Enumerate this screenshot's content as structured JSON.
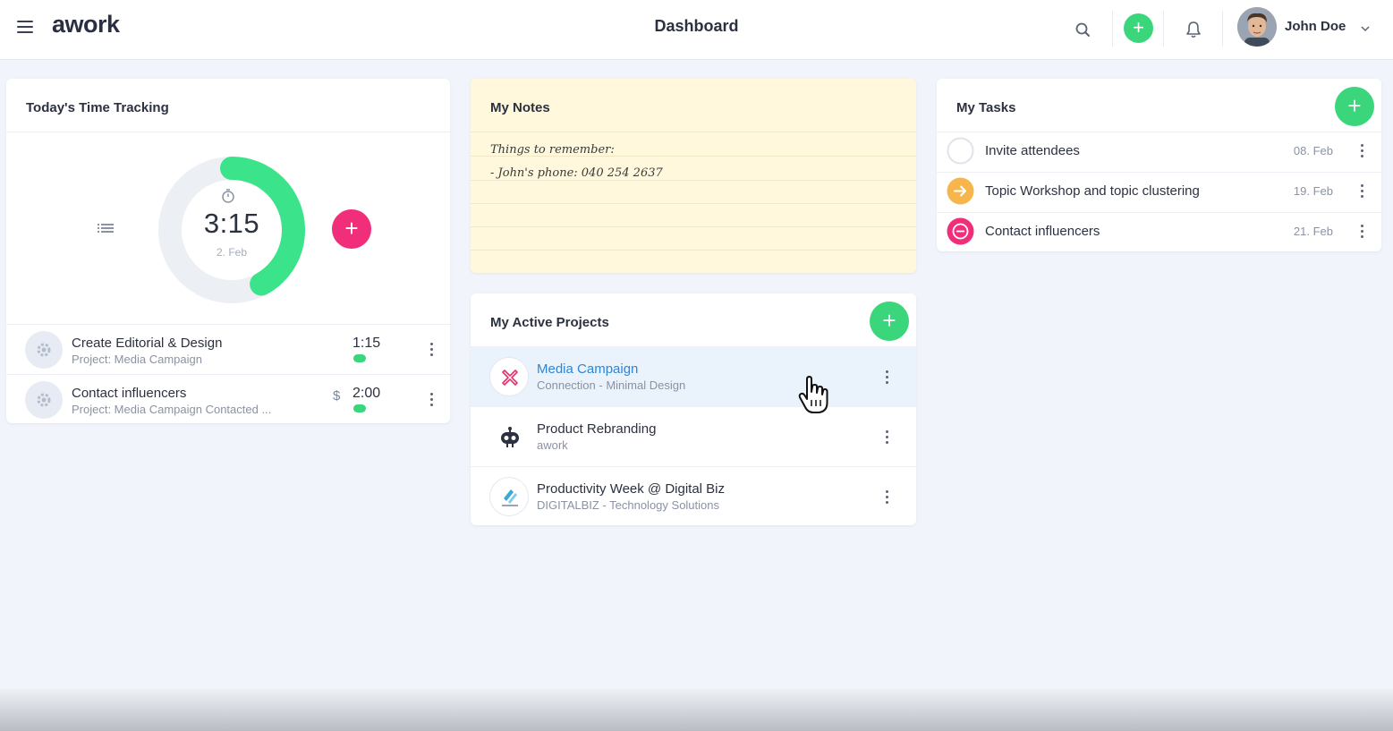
{
  "header": {
    "logo_text": "awork",
    "title": "Dashboard",
    "user_name": "John Doe",
    "add_label": "+",
    "accent": "#3bd67c"
  },
  "time_tracking": {
    "title": "Today's Time Tracking",
    "time": "3:15",
    "date": "2. Feb",
    "progress_fraction": 0.42,
    "add_label": "+",
    "entries": [
      {
        "title": "Create Editorial & Design",
        "project": "Project: Media Campaign",
        "time": "1:15",
        "billable": ""
      },
      {
        "title": "Contact influencers",
        "project": "Project: Media Campaign Contacted ...",
        "time": "2:00",
        "billable": "$"
      }
    ]
  },
  "notes": {
    "title": "My Notes",
    "lines": [
      "Things to remember:",
      "- John's phone: 040 254 2637"
    ]
  },
  "projects": {
    "title": "My Active Projects",
    "add_label": "+",
    "items": [
      {
        "title": "Media Campaign",
        "client": "Connection - Minimal Design",
        "logo_icon": "connection-logo-icon",
        "active": true
      },
      {
        "title": "Product Rebranding",
        "client": "awork",
        "logo_icon": "robot-logo-icon",
        "active": false
      },
      {
        "title": "Productivity Week @ Digital Biz",
        "client": "DIGITALBIZ - Technology Solutions",
        "logo_icon": "digitalbiz-logo-icon",
        "active": false
      }
    ]
  },
  "tasks": {
    "title": "My Tasks",
    "add_label": "+",
    "items": [
      {
        "title": "Invite attendees",
        "date": "08. Feb",
        "status": "open",
        "status_color": "#dfe3ea"
      },
      {
        "title": "Topic Workshop and topic clustering",
        "date": "19. Feb",
        "status": "in-progress",
        "status_color": "#f6b64b"
      },
      {
        "title": "Contact influencers",
        "date": "21. Feb",
        "status": "blocked",
        "status_color": "#f02e7a"
      }
    ]
  },
  "colors": {
    "green": "#3bd67c",
    "pink": "#f02e7a",
    "link_blue": "#2d86d8",
    "note_yellow": "#fff8dc"
  }
}
